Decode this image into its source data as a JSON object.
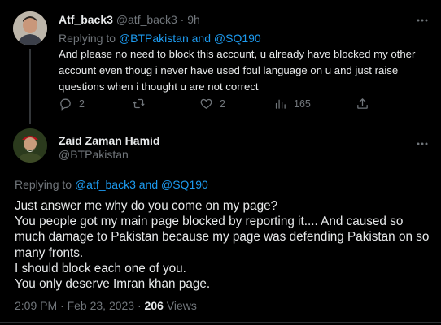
{
  "reply": {
    "display_name": "Atf_back3",
    "handle": "@atf_back3",
    "separator": "·",
    "time": "9h",
    "replying_prefix": "Replying to",
    "replying_to_1": "@BTPakistan",
    "replying_and": "and",
    "replying_to_2": "@SQ190",
    "text": "And please no need to block this account, u already have blocked my other account even thoug i never have used foul language on u and just raise questions when i thought u are not correct",
    "stats": {
      "replies": "2",
      "retweets": "",
      "likes": "2",
      "views": "165"
    }
  },
  "main": {
    "display_name": "Zaid Zaman Hamid",
    "handle": "@BTPakistan",
    "replying_prefix": "Replying to",
    "replying_to_1": "@atf_back3",
    "replying_and": "and",
    "replying_to_2": "@SQ190",
    "lines": [
      "Just answer me why do you come on my page?",
      "You people got my main page blocked by reporting it.... And caused so much damage to Pakistan because my page was defending Pakistan on so many fronts.",
      "I should block each one of you.",
      "You only deserve Imran khan page."
    ],
    "timestamp": "2:09 PM · Feb 23, 2023",
    "meta_separator": "·",
    "views_count": "206",
    "views_label": "Views"
  },
  "icons": {
    "more": "more-horizontal-icon",
    "reply": "reply-bubble-icon",
    "retweet": "retweet-icon",
    "like": "heart-icon",
    "views": "views-bar-chart-icon",
    "share": "share-icon"
  },
  "colors": {
    "background": "#000000",
    "text": "#e7e9ea",
    "muted": "#71767b",
    "link": "#1d9bf0"
  }
}
